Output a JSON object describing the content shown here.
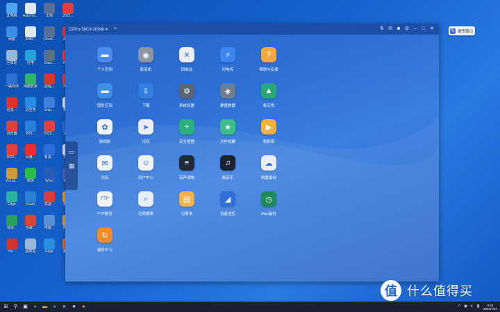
{
  "window": {
    "title": "Z2Pro-56C9-2094b ▾",
    "wifi_icon": "wifi-icon",
    "controls": [
      "pin-icon",
      "mail-icon",
      "user-icon",
      "gear-icon",
      "minimize-icon",
      "maximize-icon",
      "close-icon"
    ]
  },
  "apps": [
    {
      "label": "个人空间",
      "icon": "folder-icon",
      "glyph": "▬",
      "color": "#4a8bf2"
    },
    {
      "label": "影音机",
      "icon": "speaker-icon",
      "glyph": "◉",
      "color": "#8c95a3"
    },
    {
      "label": "回收站",
      "icon": "trash-icon",
      "glyph": "✕",
      "color": "#e9eef5"
    },
    {
      "label": "闪电传",
      "icon": "lightning-icon",
      "glyph": "⚡",
      "color": "#3b86f0"
    },
    {
      "label": "帮助与反馈",
      "icon": "help-icon",
      "glyph": "?",
      "color": "#f4a93a"
    },
    {
      "label": "团队空间",
      "icon": "team-folder-icon",
      "glyph": "▬",
      "color": "#3c8fe6"
    },
    {
      "label": "下载",
      "icon": "download-icon",
      "glyph": "⇩",
      "color": "#2f7fe2"
    },
    {
      "label": "系统设置",
      "icon": "settings-icon",
      "glyph": "⚙",
      "color": "#5a6677"
    },
    {
      "label": "硬盘数据",
      "icon": "disk-icon",
      "glyph": "◈",
      "color": "#6f7d8f"
    },
    {
      "label": "极无忧",
      "icon": "graduation-icon",
      "glyph": "▲",
      "color": "#2aa876"
    },
    {
      "label": "极相册",
      "icon": "photos-icon",
      "glyph": "✿",
      "color": "#eef1fb"
    },
    {
      "label": "迅获",
      "icon": "bird-icon",
      "glyph": "➤",
      "color": "#e9eef8"
    },
    {
      "label": "安全管理",
      "icon": "shield-icon",
      "glyph": "+",
      "color": "#2bb07e"
    },
    {
      "label": "文件收藏",
      "icon": "bookmark-icon",
      "glyph": "★",
      "color": "#3bbd86"
    },
    {
      "label": "极影视",
      "icon": "movie-icon",
      "glyph": "▶",
      "color": "#f0b23a"
    },
    {
      "label": "论坛",
      "icon": "forum-icon",
      "glyph": "✉",
      "color": "#eef2f8"
    },
    {
      "label": "用户中心",
      "icon": "user-center-icon",
      "glyph": "☺",
      "color": "#eef1f6"
    },
    {
      "label": "有声读物",
      "icon": "audio-wave-icon",
      "glyph": "≡",
      "color": "#1f2a3a"
    },
    {
      "label": "极音乐",
      "icon": "music-icon",
      "glyph": "♫",
      "color": "#1c2330"
    },
    {
      "label": "网盘备份",
      "icon": "cloud-backup-icon",
      "glyph": "☁",
      "color": "#e9eef8"
    },
    {
      "label": "FTP备份",
      "icon": "ftp-icon",
      "glyph": "FTP",
      "color": "#eef5f0"
    },
    {
      "label": "全局搜索",
      "icon": "search-icon",
      "glyph": "⌕",
      "color": "#e6f0fb"
    },
    {
      "label": "记事本",
      "icon": "notebook-icon",
      "glyph": "▤",
      "color": "#f2b24e"
    },
    {
      "label": "设备监控",
      "icon": "monitor-chart-icon",
      "glyph": "◢",
      "color": "#2e6fd8"
    },
    {
      "label": "Mac备份",
      "icon": "time-machine-icon",
      "glyph": "◷",
      "color": "#1e8a5c"
    },
    {
      "label": "备份中心",
      "icon": "backup-center-icon",
      "glyph": "↻",
      "color": "#f08a2a"
    }
  ],
  "desktop_icons": [
    {
      "label": "此电脑",
      "icon": "computer-icon",
      "color": "#4fa3f0"
    },
    {
      "label": "AutoHot...",
      "icon": "file-icon",
      "color": "#dfe7f2"
    },
    {
      "label": "文档",
      "icon": "floppy-icon",
      "color": "#5a6f96"
    },
    {
      "label": "2022...",
      "icon": "pdf-icon",
      "color": "#e24040"
    },
    {
      "label": "网络",
      "icon": "network-icon",
      "color": "#3a8ee6"
    },
    {
      "label": "Ardu...",
      "icon": "file-icon",
      "color": "#dfe7f2"
    },
    {
      "label": "Cloud...",
      "icon": "floppy-icon",
      "color": "#5a6f96"
    },
    {
      "label": "ABB...",
      "icon": "pdf-icon",
      "color": "#e24040"
    },
    {
      "label": "回收站",
      "icon": "recycle-icon",
      "color": "#9ab5d6"
    },
    {
      "label": "应用",
      "icon": "app-icon",
      "color": "#2aa0d8"
    },
    {
      "label": "Data...",
      "icon": "floppy-icon",
      "color": "#5a6f96"
    },
    {
      "label": "Aero...",
      "icon": "pdf-icon",
      "color": "#e24040"
    },
    {
      "label": "一路有你",
      "icon": "app-icon",
      "color": "#2f6fd0"
    },
    {
      "label": "电脑管家",
      "icon": "shield-icon",
      "color": "#2fb46a"
    },
    {
      "label": "远程...",
      "icon": "app-icon",
      "color": "#d23a2a"
    },
    {
      "label": "2022...",
      "icon": "pdf-icon",
      "color": "#e24040"
    },
    {
      "label": "信息...",
      "icon": "app-icon",
      "color": "#e03030"
    },
    {
      "label": "云应用",
      "icon": "app-icon",
      "color": "#2a8be0"
    },
    {
      "label": "Snip...",
      "icon": "app-icon",
      "color": "#3f7fd8"
    },
    {
      "label": "新建...",
      "icon": "file-icon",
      "color": "#dfe7f2"
    },
    {
      "label": "浏览器",
      "icon": "pdf-icon",
      "color": "#e24040"
    },
    {
      "label": "软件...",
      "icon": "app-icon",
      "color": "#2a7fd8"
    },
    {
      "label": "2022...",
      "icon": "pdf-icon",
      "color": "#e24040"
    },
    {
      "label": "文件...",
      "icon": "app-icon",
      "color": "#2f6fd0"
    },
    {
      "label": "2022...",
      "icon": "pdf-icon",
      "color": "#e24040"
    },
    {
      "label": "百度...",
      "icon": "app-icon",
      "color": "#e83030"
    },
    {
      "label": "有道...",
      "icon": "app-icon",
      "color": "#2a6fd8"
    },
    {
      "label": "文档...",
      "icon": "file-icon",
      "color": "#dfe7f2"
    },
    {
      "label": "Virtual...",
      "icon": "app-icon",
      "color": "#cf9b3a"
    },
    {
      "label": "微信",
      "icon": "wechat-icon",
      "color": "#2dbb47"
    },
    {
      "label": "Word",
      "icon": "word-icon",
      "color": "#2b5bb5"
    },
    {
      "label": "Teams",
      "icon": "teams-icon",
      "color": "#5b5fc7"
    },
    {
      "label": "Edge",
      "icon": "edge-icon",
      "color": "#2bb3a0"
    },
    {
      "label": "Flash",
      "icon": "app-icon",
      "color": "#2a7fd8"
    },
    {
      "label": "高速...",
      "icon": "app-icon",
      "color": "#e03a3a"
    },
    {
      "label": "滴答...",
      "icon": "app-icon",
      "color": "#f0a030"
    },
    {
      "label": "有道...",
      "icon": "app-icon",
      "color": "#2aa060"
    },
    {
      "label": "谷歌...",
      "icon": "app-icon",
      "color": "#d8482e"
    },
    {
      "label": "电脑...",
      "icon": "app-icon",
      "color": "#5a8fd8"
    },
    {
      "label": "陈锦...",
      "icon": "app-icon",
      "color": "#e8a23a"
    },
    {
      "label": "Pin...",
      "icon": "app-icon",
      "color": "#d0342a"
    },
    {
      "label": "回收站",
      "icon": "recycle-icon",
      "color": "#9ab5d6"
    },
    {
      "label": "Edge",
      "icon": "edge-icon",
      "color": "#2b8fe0"
    },
    {
      "label": "新建...",
      "icon": "app-icon",
      "color": "#e06a2a"
    }
  ],
  "note_widget": {
    "label": "便签笔记"
  },
  "watermark": {
    "logo": "值",
    "text": "什么值得买"
  },
  "taskbar": {
    "items": [
      "start-icon",
      "search-icon",
      "task-view-icon",
      "wechat-icon",
      "explorer-icon",
      "edge-icon",
      "app-icon",
      "app-icon",
      "app-icon"
    ],
    "clock_time": "9:34",
    "clock_date": "2023/7/27"
  }
}
